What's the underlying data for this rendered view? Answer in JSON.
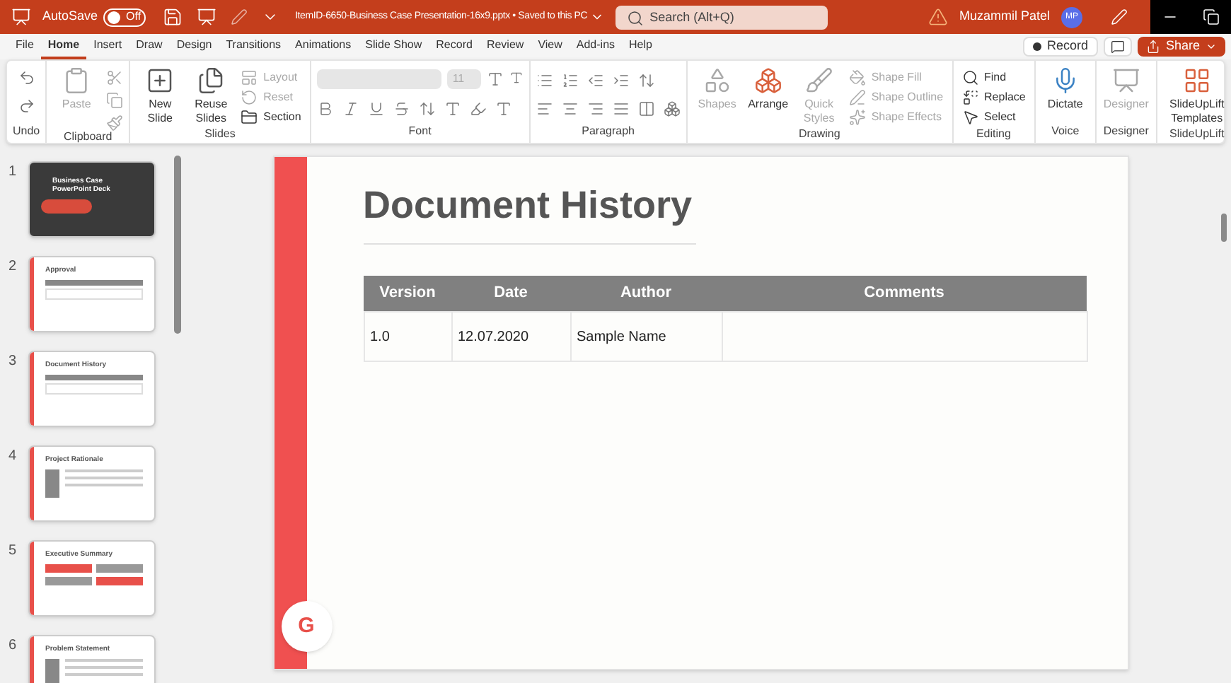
{
  "title_bar": {
    "autosave_label": "AutoSave",
    "autosave": {
      "on": false,
      "label": "Off"
    },
    "document_title": "ItemID-6650-Business Case Presentation-16x9.pptx • Saved to this PC",
    "search": {
      "placeholder": "Search (Alt+Q)"
    },
    "user_name": "Muzammil Patel",
    "avatar_initials": "MP"
  },
  "tabs": [
    {
      "label": "File",
      "selected": false
    },
    {
      "label": "Home",
      "selected": true
    },
    {
      "label": "Insert",
      "selected": false
    },
    {
      "label": "Draw",
      "selected": false
    },
    {
      "label": "Design",
      "selected": false
    },
    {
      "label": "Transitions",
      "selected": false
    },
    {
      "label": "Animations",
      "selected": false
    },
    {
      "label": "Slide Show",
      "selected": false
    },
    {
      "label": "Record",
      "selected": false
    },
    {
      "label": "Review",
      "selected": false
    },
    {
      "label": "View",
      "selected": false
    },
    {
      "label": "Add-ins",
      "selected": false
    },
    {
      "label": "Help",
      "selected": false
    }
  ],
  "record_button": "Record",
  "share_button": "Share",
  "ribbon_groups": [
    {
      "name": "Undo",
      "kind": "undo"
    },
    {
      "name": "Clipboard",
      "kind": "clipboard",
      "items": [
        {
          "label": "Paste",
          "disabled": true
        }
      ]
    },
    {
      "name": "Slides",
      "kind": "slides",
      "items": [
        {
          "label": "New Slide",
          "disabled": false
        },
        {
          "label": "Reuse Slides",
          "disabled": false
        },
        {
          "label": "Layout",
          "disabled": true
        },
        {
          "label": "Reset",
          "disabled": true
        },
        {
          "label": "Section",
          "disabled": false
        }
      ]
    },
    {
      "name": "Font",
      "kind": "font",
      "items": [
        {
          "label": "11",
          "disabled": true
        }
      ]
    },
    {
      "name": "Paragraph",
      "kind": "paragraph"
    },
    {
      "name": "Drawing",
      "kind": "drawing",
      "items": [
        {
          "label": "Shapes",
          "disabled": true
        },
        {
          "label": "Arrange",
          "disabled": false
        },
        {
          "label": "Quick Styles",
          "disabled": true
        },
        {
          "label": "Shape Fill",
          "disabled": true
        },
        {
          "label": "Shape Outline",
          "disabled": true
        },
        {
          "label": "Shape Effects",
          "disabled": true
        }
      ]
    },
    {
      "name": "Editing",
      "kind": "editing",
      "items": [
        {
          "label": "Find",
          "disabled": false
        },
        {
          "label": "Replace",
          "disabled": false
        },
        {
          "label": "Select",
          "disabled": false
        }
      ]
    },
    {
      "name": "Voice",
      "kind": "voice",
      "items": [
        {
          "label": "Dictate",
          "disabled": false
        }
      ]
    },
    {
      "name": "Designer",
      "kind": "designer",
      "items": [
        {
          "label": "Designer",
          "disabled": true
        }
      ]
    },
    {
      "name": "SlideUpLift",
      "kind": "addin",
      "items": [
        {
          "label": "SlideUpLift Templates",
          "disabled": false
        }
      ]
    }
  ],
  "thumbnails": [
    {
      "number": "1",
      "kind": "title",
      "title": "Business Case PowerPoint Deck"
    },
    {
      "number": "2",
      "kind": "table",
      "title": "Approval"
    },
    {
      "number": "3",
      "kind": "table",
      "title": "Document History"
    },
    {
      "number": "4",
      "kind": "text",
      "title": "Project Rationale"
    },
    {
      "number": "5",
      "kind": "summary",
      "title": "Executive Summary"
    },
    {
      "number": "6",
      "kind": "text",
      "title": "Problem Statement"
    }
  ],
  "slide": {
    "title": "Document History",
    "logo": "G",
    "table": {
      "columns": [
        "Version",
        "Date",
        "Author",
        "Comments"
      ],
      "rows": [
        [
          "1.0",
          "12.07.2020",
          "Sample Name"
        ]
      ]
    }
  }
}
